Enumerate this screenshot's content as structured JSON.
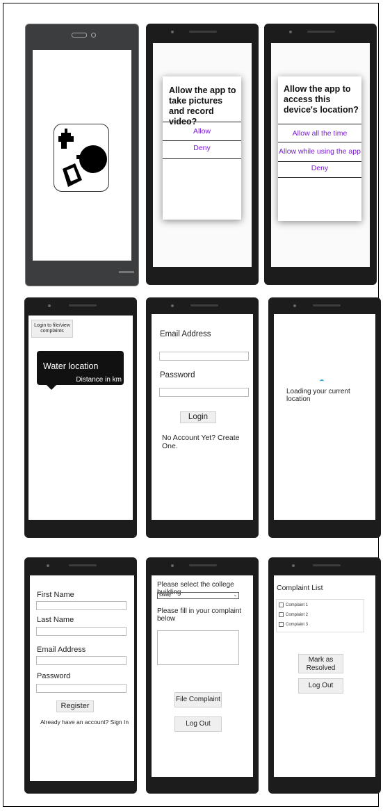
{
  "dialog_camera": {
    "title": "Allow the app to take pictures and record video?",
    "allow": "Allow",
    "deny": "Deny"
  },
  "dialog_location": {
    "title": "Allow the app to access this device's location?",
    "allow_all_time": "Allow all the time",
    "allow_while_using": "Allow while using the app",
    "deny": "Deny"
  },
  "map_screen": {
    "login_button": "Login to file/view complaints",
    "callout_title": "Water location",
    "callout_subtitle": "Distance in km"
  },
  "login_screen": {
    "email_label": "Email Address",
    "password_label": "Password",
    "login_button": "Login",
    "create_link": "No Account Yet? Create One."
  },
  "loading_screen": {
    "message": "Loading your current location"
  },
  "register_screen": {
    "first_name_label": "First Name",
    "last_name_label": "Last Name",
    "email_label": "Email Address",
    "password_label": "Password",
    "register_button": "Register",
    "signin_link": "Already have an account? Sign In"
  },
  "complaint_screen": {
    "building_prompt": "Please select the college building",
    "building_selected": "Shelby",
    "complaint_prompt": "Please fill in your complaint below",
    "file_button": "File Complaint",
    "logout_button": "Log Out"
  },
  "list_screen": {
    "title": "Complaint List",
    "items": [
      "Complaint 1",
      "Complaint 2",
      "Complaint 3"
    ],
    "resolve_button": "Mark as Resolved",
    "logout_button": "Log Out"
  },
  "colors": {
    "dialog_accent": "#7a1ad6",
    "phone_body": "#1c1c1c",
    "callout_bg": "#111111",
    "spinner": "#2aa8d8"
  }
}
